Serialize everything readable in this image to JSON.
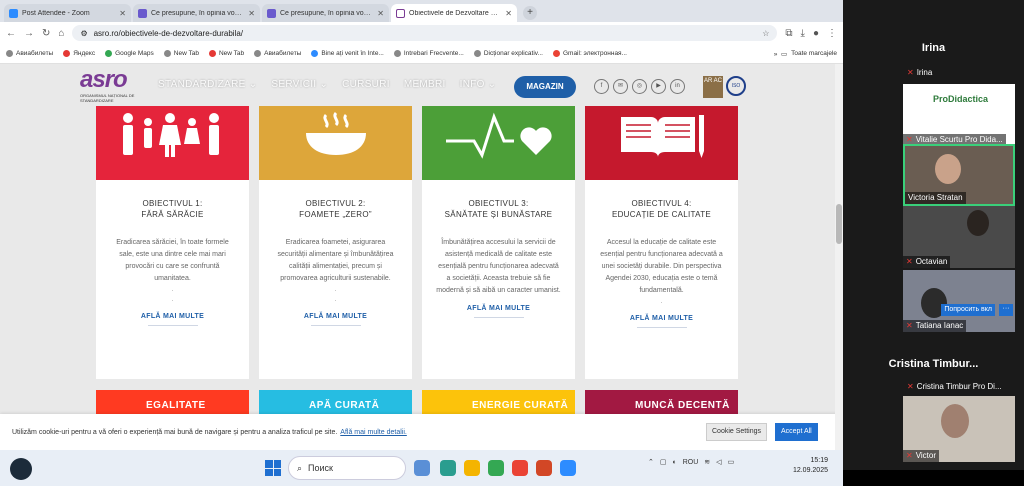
{
  "browser": {
    "tabs": [
      {
        "title": "Post Attendee - Zoom",
        "color": "#2d8cff",
        "active": false
      },
      {
        "title": "Ce presupune, în opinia voastră",
        "color": "#6a5acd",
        "active": false
      },
      {
        "title": "Ce presupune, în opinia voastră",
        "color": "#6a5acd",
        "active": false
      },
      {
        "title": "Obiectivele de Dezvoltare Dura",
        "color": "#7a3b94",
        "active": true
      }
    ],
    "url": "asro.ro/obiectivele-de-dezvoltare-durabila/",
    "bookmarks": [
      "Авиабилеты",
      "Яндекс",
      "Google Maps",
      "New Tab",
      "New Tab",
      "Авиабилеты",
      "Bine ați venit în Inte...",
      "Intrebari Frecvente...",
      "Dicționar explicativ...",
      "Gmail: электронная..."
    ],
    "all_bookmarks": "Toate marcajele"
  },
  "site": {
    "logo_main": "asro",
    "logo_sub": "ORGANISMUL NAȚIONAL DE STANDARDIZARE",
    "nav": [
      "STANDARDIZARE ⌄",
      "SERVICII ⌄",
      "CURSURI",
      "MEMBRI",
      "INFO ⌄"
    ],
    "magazin": "MAGAZIN",
    "badge1": "AR AC",
    "badge2": "ISO",
    "socials": [
      "f",
      "✉",
      "◎",
      "▶",
      "in"
    ]
  },
  "cards": [
    {
      "color": "#e5243b",
      "icon": "family-icon",
      "title1": "OBIECTIVUL 1:",
      "title2": "FĂRĂ SĂRĂCIE",
      "body": "Eradicarea sărăciei, în toate formele sale, este una dintre cele mai mari provocări cu care se confruntă umanitatea.",
      "link": "AFLĂ MAI MULTE"
    },
    {
      "color": "#dda63a",
      "icon": "bowl-icon",
      "title1": "OBIECTIVUL 2:",
      "title2": "FOAMETE „ZERO”",
      "body": "Eradicarea foametei, asigurarea securității alimentare și îmbunătățirea calității alimentației, precum și promovarea agriculturii sustenabile.",
      "link": "AFLĂ MAI MULTE"
    },
    {
      "color": "#4c9f38",
      "icon": "heartbeat-icon",
      "title1": "OBIECTIVUL 3:",
      "title2": "SĂNĂTATE ȘI BUNĂSTARE",
      "body": "Îmbunătățirea accesului la servicii de asistență medicală de calitate este esențială pentru funcționarea adecvată a societății. Aceasta trebuie să fie modernă și să aibă un caracter umanist.",
      "link": "AFLĂ MAI MULTE"
    },
    {
      "color": "#c5192d",
      "icon": "book-icon",
      "title1": "OBIECTIVUL 4:",
      "title2": "EDUCAȚIE DE CALITATE",
      "body": "Accesul la educație de calitate este esențial pentru funcționarea adecvată a unei societăți durabile. Din perspectiva Agendei 2030, educația este o temă fundamentală.",
      "link": "AFLĂ MAI MULTE"
    }
  ],
  "cards2": [
    {
      "label": "EGALITATE",
      "color": "#ff3a21"
    },
    {
      "label": "APĂ CURATĂ",
      "color": "#26bde2"
    },
    {
      "label": "ENERGIE CURATĂ",
      "color": "#fcc30b"
    },
    {
      "label": "MUNCĂ DECENTĂ",
      "color": "#a21942"
    }
  ],
  "cookie": {
    "text": "Utilizăm cookie-uri pentru a vă oferi o experiență mai bună de navigare și pentru a analiza traficul pe site.",
    "link": "Află mai multe detalii.",
    "settings": "Cookie Settings",
    "accept": "Accept All"
  },
  "zoom": {
    "top_name": "Irina",
    "participants": [
      {
        "name": "Irina",
        "tile": false
      },
      {
        "name": "Vitalie Scurtu Pro Dida...",
        "tile": true,
        "bg": "#ffffff"
      },
      {
        "name": "Victoria Stratan",
        "tile": true,
        "bg": "#6a5d52",
        "active": true
      },
      {
        "name": "Octavian",
        "tile": true,
        "bg": "#4a4a4a"
      },
      {
        "name": "Tatiana Ianac",
        "tile": true,
        "bg": "#7d8290"
      }
    ],
    "section_name": "Cristina Timbur...",
    "cristina_label": "Cristina Timbur Pro Di...",
    "victor": "Victor",
    "ask_button": "Попросить вкл",
    "more": "···",
    "logo_text": "ProDidactica"
  },
  "taskbar": {
    "search": "Поиск",
    "lang": "ROU",
    "time": "15:19",
    "date": "12.09.2025"
  }
}
